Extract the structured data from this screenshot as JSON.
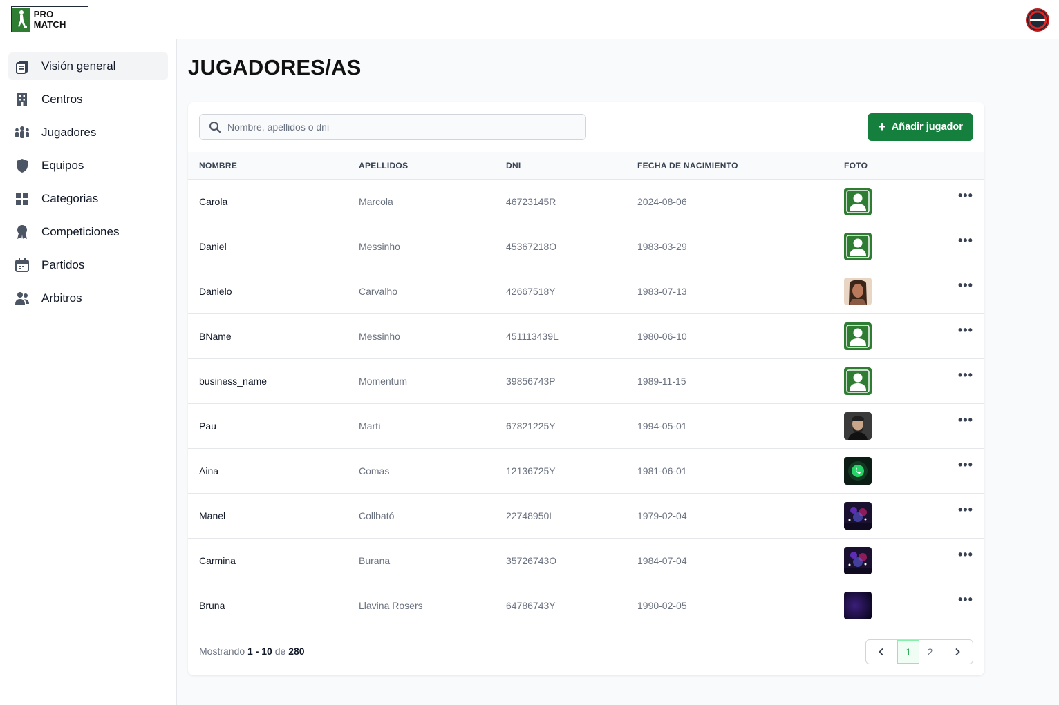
{
  "header": {
    "logo_text": "PRO MATCH"
  },
  "sidebar": {
    "items": [
      {
        "label": "Visión general",
        "icon": "clipboard-icon",
        "active": true
      },
      {
        "label": "Centros",
        "icon": "building-icon"
      },
      {
        "label": "Jugadores",
        "icon": "users-group-icon"
      },
      {
        "label": "Equipos",
        "icon": "shield-icon"
      },
      {
        "label": "Categorias",
        "icon": "grid-icon"
      },
      {
        "label": "Competiciones",
        "icon": "award-icon"
      },
      {
        "label": "Partidos",
        "icon": "calendar-icon"
      },
      {
        "label": "Arbitros",
        "icon": "users-icon"
      }
    ]
  },
  "main": {
    "title": "JUGADORES/AS",
    "search_placeholder": "Nombre, apellidos o dni",
    "add_button_label": "Añadir jugador",
    "columns": [
      "NOMBRE",
      "APELLIDOS",
      "DNI",
      "FECHA DE NACIMIENTO",
      "FOTO"
    ],
    "rows": [
      {
        "nombre": "Carola",
        "apellidos": "Marcola",
        "dni": "46723145R",
        "fecha": "2024-08-06",
        "foto": "default-avatar"
      },
      {
        "nombre": "Daniel",
        "apellidos": "Messinho",
        "dni": "45367218O",
        "fecha": "1983-03-29",
        "foto": "default-avatar"
      },
      {
        "nombre": "Danielo",
        "apellidos": "Carvalho",
        "dni": "42667518Y",
        "fecha": "1983-07-13",
        "foto": "portrait-woman"
      },
      {
        "nombre": "BName",
        "apellidos": "Messinho",
        "dni": "451113439L",
        "fecha": "1980-06-10",
        "foto": "default-avatar"
      },
      {
        "nombre": "business_name",
        "apellidos": "Momentum",
        "dni": "39856743P",
        "fecha": "1989-11-15",
        "foto": "default-avatar"
      },
      {
        "nombre": "Pau",
        "apellidos": "Martí",
        "dni": "67821225Y",
        "fecha": "1994-05-01",
        "foto": "portrait-man"
      },
      {
        "nombre": "Aina",
        "apellidos": "Comas",
        "dni": "12136725Y",
        "fecha": "1981-06-01",
        "foto": "whatsapp-logo"
      },
      {
        "nombre": "Manel",
        "apellidos": "Collbató",
        "dni": "22748950L",
        "fecha": "1979-02-04",
        "foto": "concert-photo"
      },
      {
        "nombre": "Carmina",
        "apellidos": "Burana",
        "dni": "35726743O",
        "fecha": "1984-07-04",
        "foto": "concert-photo"
      },
      {
        "nombre": "Bruna",
        "apellidos": "Llavina Rosers",
        "dni": "64786743Y",
        "fecha": "1990-02-05",
        "foto": "dark-abstract"
      }
    ],
    "row_action_label": "•••",
    "footer": {
      "prefix": "Mostrando",
      "range": "1 - 10",
      "of": "de",
      "total": "280"
    },
    "pagination": {
      "prev": "‹",
      "pages": [
        "1",
        "2"
      ],
      "current": "1",
      "next": "›"
    }
  },
  "colors": {
    "accent": "#15803d",
    "avatar_green": "#2e7d32"
  }
}
